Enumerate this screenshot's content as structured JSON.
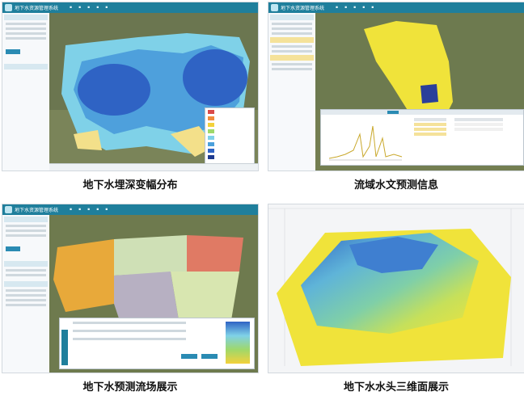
{
  "app": {
    "title": "地下水资源管理系统"
  },
  "panels": [
    {
      "caption": "地下水埋深变幅分布"
    },
    {
      "caption": "流域水文预测信息"
    },
    {
      "caption": "地下水预测流场展示"
    },
    {
      "caption": "地下水水头三维面展示"
    }
  ],
  "colors": {
    "topbar": "#1f7f9c",
    "terrain": "#6f7a4e",
    "water_deep": "#2f63c4",
    "water_mid": "#4ea0dc",
    "basin_yellow": "#f0e33a"
  },
  "legend1": [
    {
      "color": "#d94a4a"
    },
    {
      "color": "#f08a3c"
    },
    {
      "color": "#f3d13b"
    },
    {
      "color": "#9fd86a"
    },
    {
      "color": "#7fd1e8"
    },
    {
      "color": "#4aa0dc"
    },
    {
      "color": "#2f63c4"
    },
    {
      "color": "#1d3a8f"
    }
  ]
}
